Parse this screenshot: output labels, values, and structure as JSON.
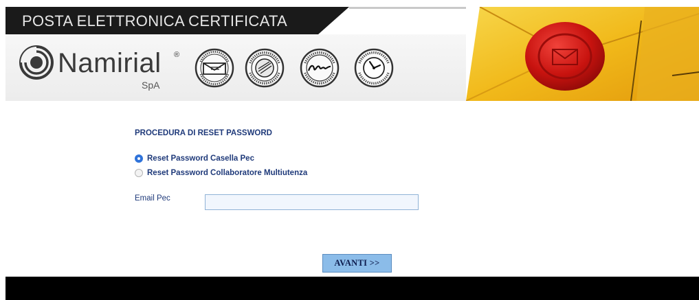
{
  "header": {
    "title": "POSTA ELETTRONICA CERTIFICATA",
    "logo": {
      "name": "Namirial",
      "registered": "®",
      "suffix": "SpA",
      "icon": "namirial-logo-icon"
    },
    "seals": [
      {
        "icon": "sicurezza-postale-seal-icon"
      },
      {
        "icon": "firma-certa-certification-authority-seal-icon"
      },
      {
        "icon": "firma-certa-grafometrica-seal-icon"
      },
      {
        "icon": "firma-certa-time-stamping-seal-icon"
      }
    ],
    "banner_icon": "yellow-envelope-wax-seal-icon"
  },
  "form": {
    "section_title": "PROCEDURA DI RESET PASSWORD",
    "options": [
      {
        "label": "Reset Password Casella Pec",
        "checked": true
      },
      {
        "label": "Reset Password Collaboratore Multiutenza",
        "checked": false
      }
    ],
    "email_label": "Email Pec",
    "email_value": "",
    "email_placeholder": "",
    "submit_label": "AVANTI >>"
  },
  "colors": {
    "label_text": "#1f3a7a",
    "radio_selected": "#2f73da",
    "button_bg": "#8bbce9",
    "input_bg": "#f1f6fd",
    "header_bar": "#1a1a1a",
    "footer": "#000000"
  }
}
